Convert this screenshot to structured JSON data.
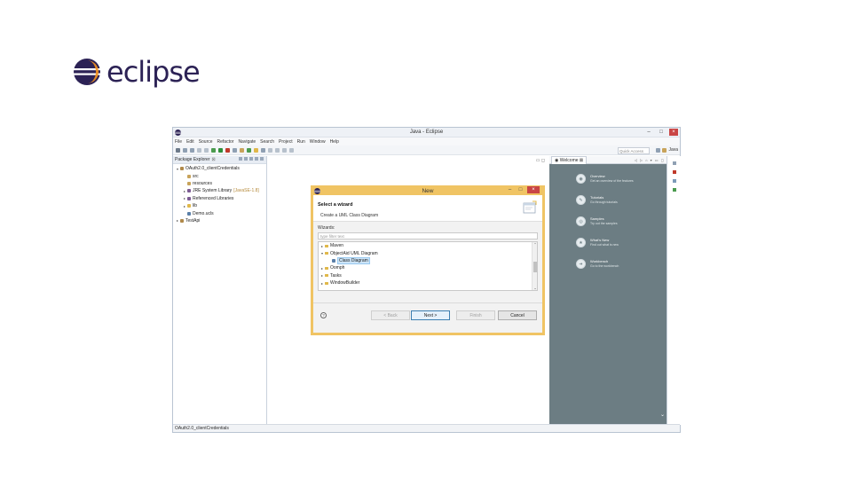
{
  "logo": {
    "text": "eclipse"
  },
  "window": {
    "title": "Java - Eclipse",
    "controls": [
      "–",
      "□",
      "×"
    ]
  },
  "menubar": [
    "File",
    "Edit",
    "Source",
    "Refactor",
    "Navigate",
    "Search",
    "Project",
    "Run",
    "Window",
    "Help"
  ],
  "toolbar": {
    "quick_access_placeholder": "Quick Access",
    "perspective_label": "Java"
  },
  "package_explorer": {
    "title": "Package Explorer",
    "items": [
      {
        "label": "OAuth2.0_clientCredentials",
        "indent": 0,
        "arrow": "▾",
        "color": "#b0894a"
      },
      {
        "label": "src",
        "indent": 1,
        "arrow": "",
        "color": "#c8a35a"
      },
      {
        "label": "resources",
        "indent": 1,
        "arrow": "",
        "color": "#c8a35a"
      },
      {
        "label": "JRE System Library",
        "suffix": "[JavaSE-1.8]",
        "indent": 1,
        "arrow": "▸",
        "color": "#7c5b93"
      },
      {
        "label": "Referenced Libraries",
        "indent": 1,
        "arrow": "▸",
        "color": "#7c5b93"
      },
      {
        "label": "lib",
        "indent": 1,
        "arrow": "▸",
        "color": "#e0b84a"
      },
      {
        "label": "Demo.ucls",
        "indent": 1,
        "arrow": "",
        "color": "#5a7fa8"
      },
      {
        "label": "TestApi",
        "indent": 0,
        "arrow": "▸",
        "color": "#b0894a"
      }
    ]
  },
  "welcome": {
    "tab_label": "Welcome",
    "items": [
      {
        "title": "Overview",
        "desc": "Get an overview of the features",
        "glyph": "◉"
      },
      {
        "title": "Tutorials",
        "desc": "Go through tutorials",
        "glyph": "✎"
      },
      {
        "title": "Samples",
        "desc": "Try out the samples",
        "glyph": "◎"
      },
      {
        "title": "What's New",
        "desc": "Find out what is new",
        "glyph": "★"
      },
      {
        "title": "Workbench",
        "desc": "Go to the workbench",
        "glyph": "➜"
      }
    ]
  },
  "status_bar": {
    "text": "OAuth2.0_clientCredentials"
  },
  "dialog": {
    "title": "New",
    "header_title": "Select a wizard",
    "header_desc": "Create a UML Class Diagram",
    "wizards_label": "Wizards:",
    "filter_placeholder": "type filter text",
    "tree": [
      {
        "label": "Maven",
        "arrow": "▸",
        "indent": 0,
        "selected": false,
        "folder": true
      },
      {
        "label": "ObjectAid UML Diagram",
        "arrow": "▾",
        "indent": 0,
        "selected": false,
        "folder": true
      },
      {
        "label": "Class Diagram",
        "arrow": "",
        "indent": 1,
        "selected": true,
        "folder": false
      },
      {
        "label": "Oomph",
        "arrow": "▸",
        "indent": 0,
        "selected": false,
        "folder": true
      },
      {
        "label": "Tasks",
        "arrow": "▸",
        "indent": 0,
        "selected": false,
        "folder": true
      },
      {
        "label": "WindowBuilder",
        "arrow": "▸",
        "indent": 0,
        "selected": false,
        "folder": true
      }
    ],
    "buttons": {
      "help": "?",
      "back": "< Back",
      "next": "Next >",
      "finish": "Finish",
      "cancel": "Cancel"
    }
  },
  "colors": {
    "dialog_border": "#f0c464",
    "welcome_bg": "#6c7d83",
    "selection": "#cce4f7",
    "logo_text": "#2c2255"
  }
}
